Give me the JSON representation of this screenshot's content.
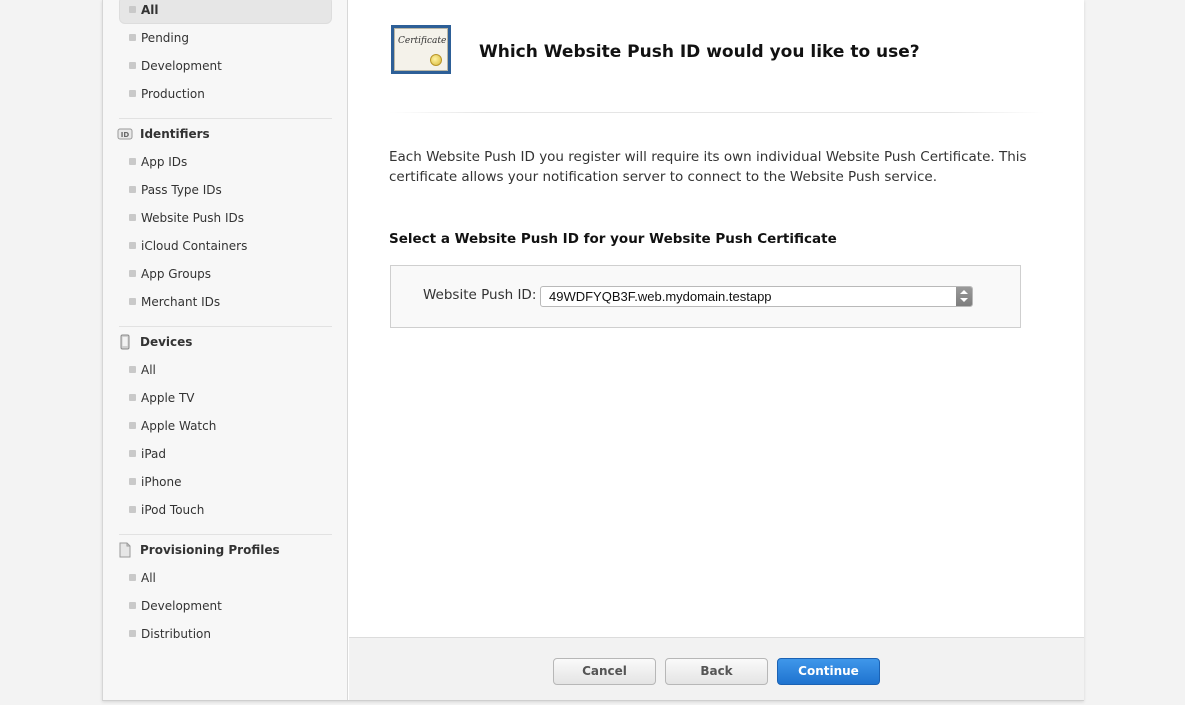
{
  "sidebar": {
    "certificates": {
      "items": [
        {
          "label": "All",
          "active": true
        },
        {
          "label": "Pending"
        },
        {
          "label": "Development"
        },
        {
          "label": "Production"
        }
      ]
    },
    "identifiers": {
      "title": "Identifiers",
      "icon": "id-icon",
      "icon_text": "ID",
      "items": [
        {
          "label": "App IDs"
        },
        {
          "label": "Pass Type IDs"
        },
        {
          "label": "Website Push IDs"
        },
        {
          "label": "iCloud Containers"
        },
        {
          "label": "App Groups"
        },
        {
          "label": "Merchant IDs"
        }
      ]
    },
    "devices": {
      "title": "Devices",
      "icon": "phone-icon",
      "items": [
        {
          "label": "All"
        },
        {
          "label": "Apple TV"
        },
        {
          "label": "Apple Watch"
        },
        {
          "label": "iPad"
        },
        {
          "label": "iPhone"
        },
        {
          "label": "iPod Touch"
        }
      ]
    },
    "profiles": {
      "title": "Provisioning Profiles",
      "icon": "document-icon",
      "items": [
        {
          "label": "All"
        },
        {
          "label": "Development"
        },
        {
          "label": "Distribution"
        }
      ]
    }
  },
  "main": {
    "icon": "certificate-icon",
    "icon_text": "Certificate",
    "title": "Which Website Push ID would you like to use?",
    "description": "Each Website Push ID you register will require its own individual Website Push Certificate. This certificate allows your notification server to connect to the Website Push service.",
    "section_heading": "Select a Website Push ID for your Website Push Certificate",
    "select": {
      "label": "Website Push ID:",
      "value": "49WDFYQB3F.web.mydomain.testapp"
    }
  },
  "footer": {
    "cancel_label": "Cancel",
    "back_label": "Back",
    "continue_label": "Continue"
  },
  "colors": {
    "primary_button": "#2a82dd",
    "sidebar_bg": "#f7f7f7",
    "certificate_border": "#2d5f97"
  }
}
